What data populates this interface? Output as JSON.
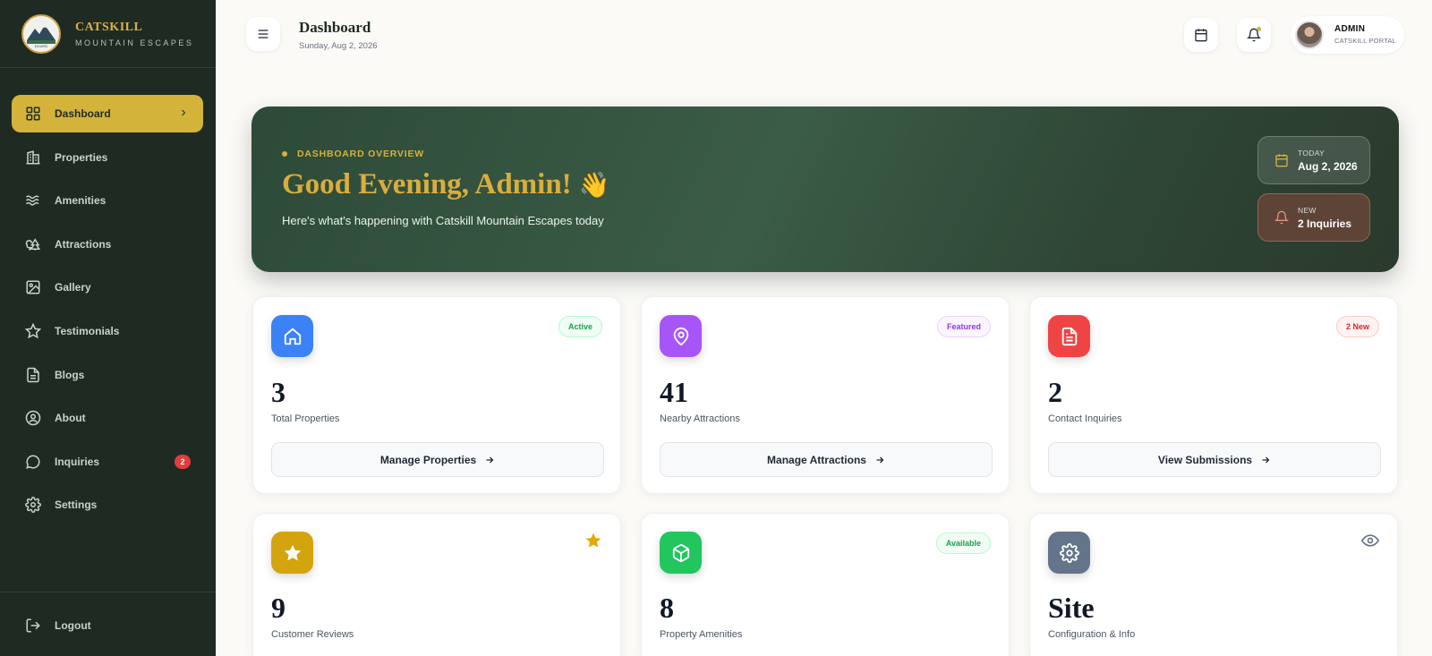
{
  "brand": {
    "name": "CATSKILL",
    "subtitle": "MOUNTAIN ESCAPES",
    "logo_text": "CATSKILL MOUNTAIN ESCAPES"
  },
  "sidebar": {
    "items": [
      {
        "label": "Dashboard",
        "icon": "grid-icon",
        "active": true
      },
      {
        "label": "Properties",
        "icon": "building-icon"
      },
      {
        "label": "Amenities",
        "icon": "waves-icon"
      },
      {
        "label": "Attractions",
        "icon": "trees-icon"
      },
      {
        "label": "Gallery",
        "icon": "image-icon"
      },
      {
        "label": "Testimonials",
        "icon": "star-icon"
      },
      {
        "label": "Blogs",
        "icon": "document-icon"
      },
      {
        "label": "About",
        "icon": "user-circle-icon"
      },
      {
        "label": "Inquiries",
        "icon": "chat-icon",
        "badge": "2"
      },
      {
        "label": "Settings",
        "icon": "gear-icon"
      }
    ],
    "logout_label": "Logout"
  },
  "header": {
    "title": "Dashboard",
    "date": "Sunday, Aug 2, 2026",
    "user_name": "ADMIN",
    "user_role": "CATSKILL PORTAL"
  },
  "hero": {
    "kicker": "DASHBOARD OVERVIEW",
    "greeting": "Good Evening, Admin!",
    "emoji": "👋",
    "subtitle": "Here's what's happening with Catskill Mountain Escapes today",
    "today_label": "TODAY",
    "today_value": "Aug 2, 2026",
    "new_label": "NEW",
    "new_value": "2 Inquiries"
  },
  "cards": [
    {
      "value": "3",
      "label": "Total Properties",
      "tag": "Active",
      "button": "Manage Properties",
      "icon": "home-icon",
      "color": "#3b82f6"
    },
    {
      "value": "41",
      "label": "Nearby Attractions",
      "tag": "Featured",
      "button": "Manage Attractions",
      "icon": "map-pin-icon",
      "color": "#a855f7"
    },
    {
      "value": "2",
      "label": "Contact Inquiries",
      "tag": "2 New",
      "button": "View Submissions",
      "icon": "file-icon",
      "color": "#ef4444"
    },
    {
      "value": "9",
      "label": "Customer Reviews",
      "icon": "star-icon",
      "color": "#d4a40f"
    },
    {
      "value": "8",
      "label": "Property Amenities",
      "tag": "Available",
      "icon": "box-icon",
      "color": "#22c55e"
    },
    {
      "value": "Site",
      "label": "Configuration & Info",
      "icon": "gear-icon",
      "color": "#64748b"
    }
  ],
  "colors": {
    "sidebar_bg": "#1f2b22",
    "accent_gold": "#d4b33b",
    "hero_green": "#2d4a38"
  }
}
